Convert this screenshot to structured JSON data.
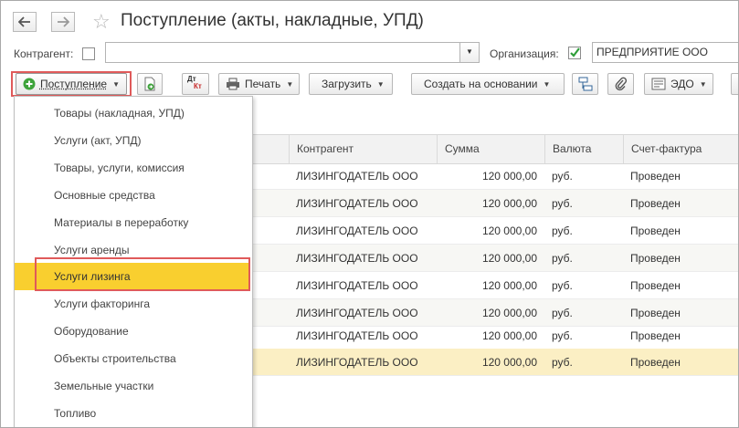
{
  "window": {
    "title": "Поступление (акты, накладные, УПД)"
  },
  "filters": {
    "counterparty_label": "Контрагент:",
    "counterparty_value": "",
    "organization_label": "Организация:",
    "organization_value": "ПРЕДПРИЯТИЕ ООО"
  },
  "toolbar": {
    "receipt_label": "Поступление",
    "print_label": "Печать",
    "load_label": "Загрузить",
    "create_based_label": "Создать на основании",
    "edo_label": "ЭДО"
  },
  "menu": {
    "items": [
      "Товары (накладная, УПД)",
      "Услуги (акт, УПД)",
      "Товары, услуги, комиссия",
      "Основные средства",
      "Материалы в переработку",
      "Услуги аренды",
      "Услуги лизинга",
      "Услуги факторинга",
      "Оборудование",
      "Объекты строительства",
      "Земельные участки",
      "Топливо"
    ],
    "active_item": "Услуги лизинга"
  },
  "table": {
    "columns": [
      "Контрагент",
      "Сумма",
      "Валюта",
      "Счет-фактура"
    ],
    "rows": [
      [
        "ЛИЗИНГОДАТЕЛЬ ООО",
        "120 000,00",
        "руб.",
        "Проведен"
      ],
      [
        "ЛИЗИНГОДАТЕЛЬ ООО",
        "120 000,00",
        "руб.",
        "Проведен"
      ],
      [
        "ЛИЗИНГОДАТЕЛЬ ООО",
        "120 000,00",
        "руб.",
        "Проведен"
      ],
      [
        "ЛИЗИНГОДАТЕЛЬ ООО",
        "120 000,00",
        "руб.",
        "Проведен"
      ],
      [
        "ЛИЗИНГОДАТЕЛЬ ООО",
        "120 000,00",
        "руб.",
        "Проведен"
      ],
      [
        "ЛИЗИНГОДАТЕЛЬ ООО",
        "120 000,00",
        "руб.",
        "Проведен"
      ],
      [
        "ЛИЗИНГОДАТЕЛЬ ООО",
        "120 000,00",
        "руб.",
        "Проведен"
      ],
      [
        "ЛИЗИНГОДАТЕЛЬ ООО",
        "120 000,00",
        "руб.",
        "Проведен"
      ]
    ]
  },
  "icons": {
    "dt_kt_top": "Дт",
    "dt_kt_bottom": "Кт"
  },
  "colors": {
    "highlight_yellow": "#f9cf2f",
    "selected_row": "#fbefc4",
    "annotation_red": "#e05a5a",
    "checkbox_green": "#2f9e3a"
  }
}
